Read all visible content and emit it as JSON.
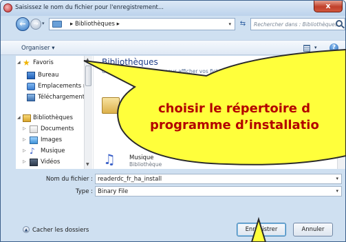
{
  "window": {
    "title": "Saisissez le nom du fichier pour l'enregistrement...",
    "close_label": "x"
  },
  "navbar": {
    "back_glyph": "←",
    "forward_glyph": "→",
    "address_path": "▸ Bibliothèques ▸",
    "search_placeholder": "Rechercher dans : Bibliothèques"
  },
  "toolbar": {
    "organize_label": "Organiser ▾",
    "help_glyph": "?"
  },
  "sidebar": {
    "favorites_label": "Favoris",
    "items": [
      {
        "label": "Bureau"
      },
      {
        "label": "Emplacements ré"
      },
      {
        "label": "Téléchargements"
      }
    ],
    "libraries_label": "Bibliothèques",
    "library_items": [
      {
        "label": "Documents"
      },
      {
        "label": "Images"
      },
      {
        "label": "Musique"
      },
      {
        "label": "Vidéos"
      }
    ]
  },
  "main": {
    "title": "Bibliothèques",
    "subtitle": "Ouvrir une bibliothèque pour afficher vos fichiers et les organiser par dossier, date et selo...",
    "music_name": "Musique",
    "music_type": "Bibliothèque"
  },
  "fields": {
    "filename_label": "Nom du fichier :",
    "filename_value": "readerdc_fr_ha_install",
    "type_label": "Type :",
    "type_value": "Binary File"
  },
  "footer": {
    "hide_folders_label": "Cacher les dossiers",
    "save_label": "Enregistrer",
    "cancel_label": "Annuler"
  },
  "callout": {
    "line1": "choisir le répertoire d",
    "line2": "programme d’installatio"
  },
  "colors": {
    "callout_fill": "#ffff3b",
    "callout_text": "#b30000",
    "window_border": "#3b5f8a"
  }
}
